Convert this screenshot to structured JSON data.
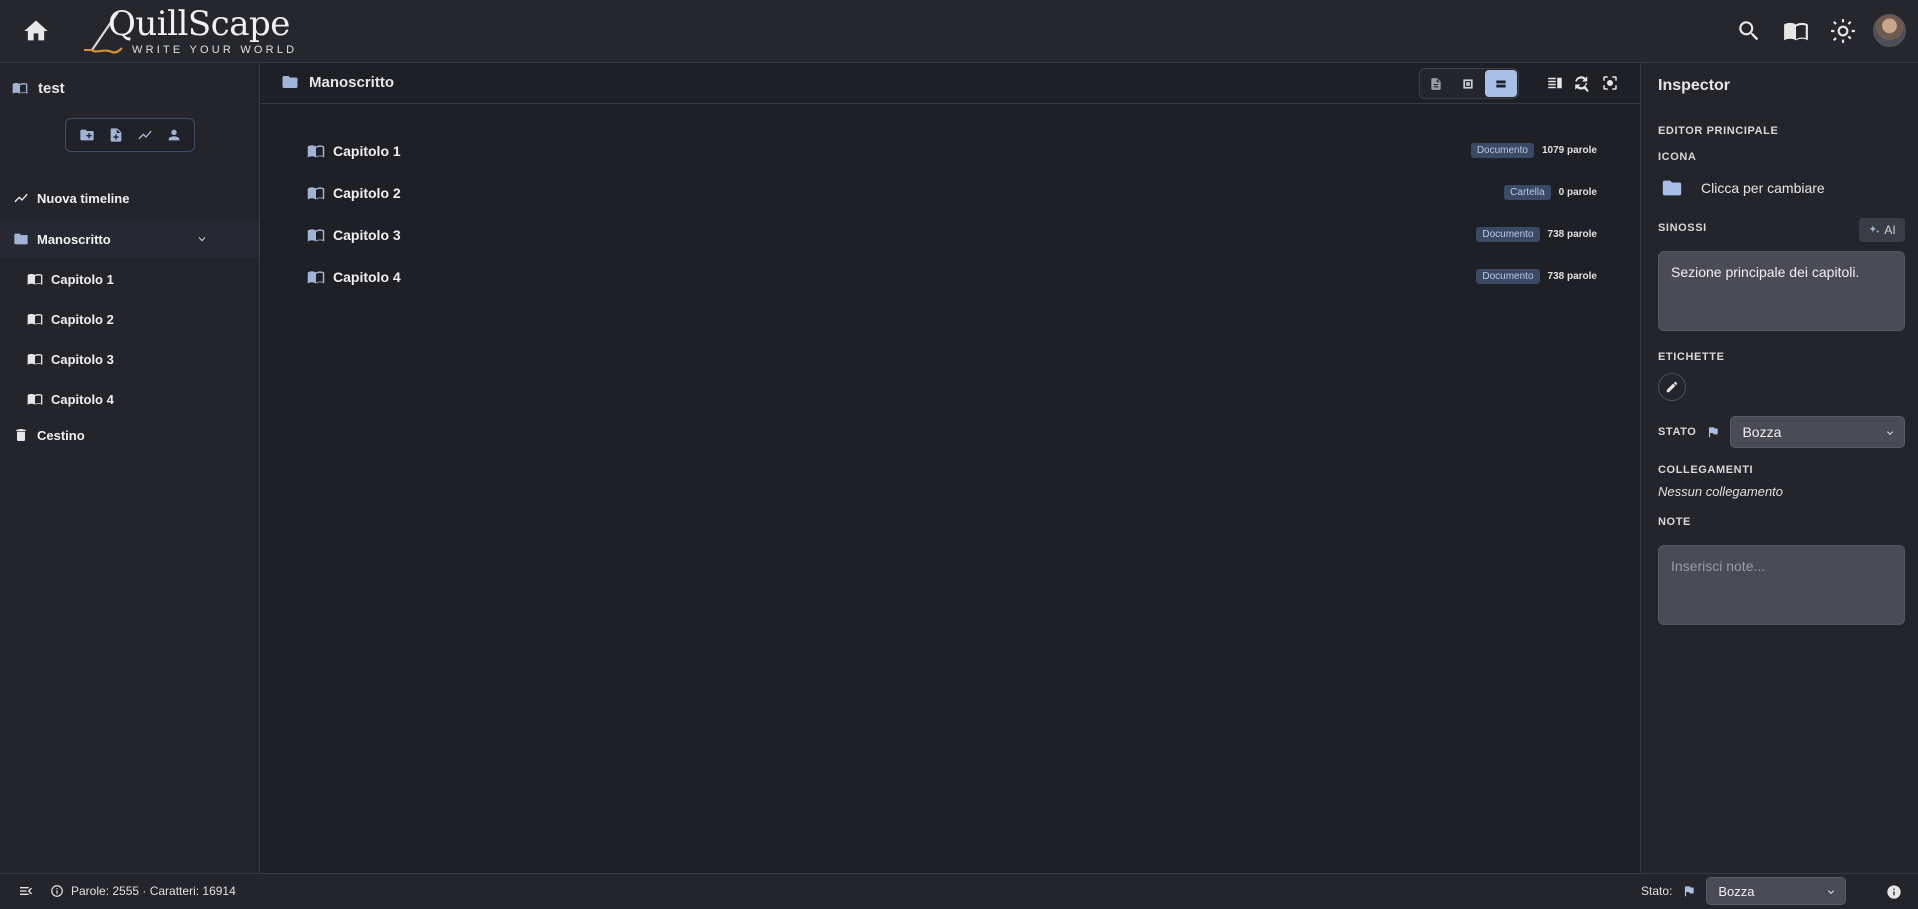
{
  "header": {
    "logo_word": "QuillScape",
    "logo_tagline": "WRITE YOUR WORLD",
    "icons": [
      "home-icon",
      "search-icon",
      "book-open-icon",
      "sun-icon",
      "avatar"
    ]
  },
  "sidebar": {
    "project_title": "test",
    "toolbar_icons": [
      "new-folder-icon",
      "new-document-icon",
      "timeline-icon",
      "person-icon"
    ],
    "items": [
      {
        "label": "Nuova timeline",
        "icon": "timeline-icon"
      },
      {
        "label": "Manoscritto",
        "icon": "folder-icon",
        "expanded": true
      },
      {
        "label": "Capitolo 1",
        "icon": "book-icon"
      },
      {
        "label": "Capitolo 2",
        "icon": "book-icon"
      },
      {
        "label": "Capitolo 3",
        "icon": "book-icon"
      },
      {
        "label": "Capitolo 4",
        "icon": "book-icon"
      },
      {
        "label": "Cestino",
        "icon": "trash-icon"
      }
    ]
  },
  "main": {
    "title": "Manoscritto",
    "view_modes": [
      "document-view",
      "grid-view",
      "list-view"
    ],
    "active_view": "list-view",
    "documents": [
      {
        "title": "Capitolo 1",
        "type": "Documento",
        "words": "1079 parole"
      },
      {
        "title": "Capitolo 2",
        "type": "Cartella",
        "words": "0 parole"
      },
      {
        "title": "Capitolo 3",
        "type": "Documento",
        "words": "738 parole"
      },
      {
        "title": "Capitolo 4",
        "type": "Documento",
        "words": "738 parole"
      }
    ]
  },
  "inspector": {
    "title": "Inspector",
    "section_editor": "EDITOR PRINCIPALE",
    "label_icon": "ICONA",
    "icon_change_text": "Clicca per cambiare",
    "label_synopsis": "SINOSSI",
    "ai_button": "AI",
    "synopsis_value": "Sezione principale dei capitoli.",
    "label_tags": "ETICHETTE",
    "label_status": "STATO",
    "status_value": "Bozza",
    "label_links": "COLLEGAMENTI",
    "links_empty": "Nessun collegamento",
    "label_notes": "NOTE",
    "notes_placeholder": "Inserisci note..."
  },
  "footer": {
    "stats": "Parole: 2555 · Caratteri: 16914",
    "status_label": "Stato:",
    "status_value": "Bozza"
  },
  "colors": {
    "background": "#1f2025",
    "panel": "#24252a",
    "accent": "#a8c0e8",
    "badge": "#3a4a66"
  }
}
